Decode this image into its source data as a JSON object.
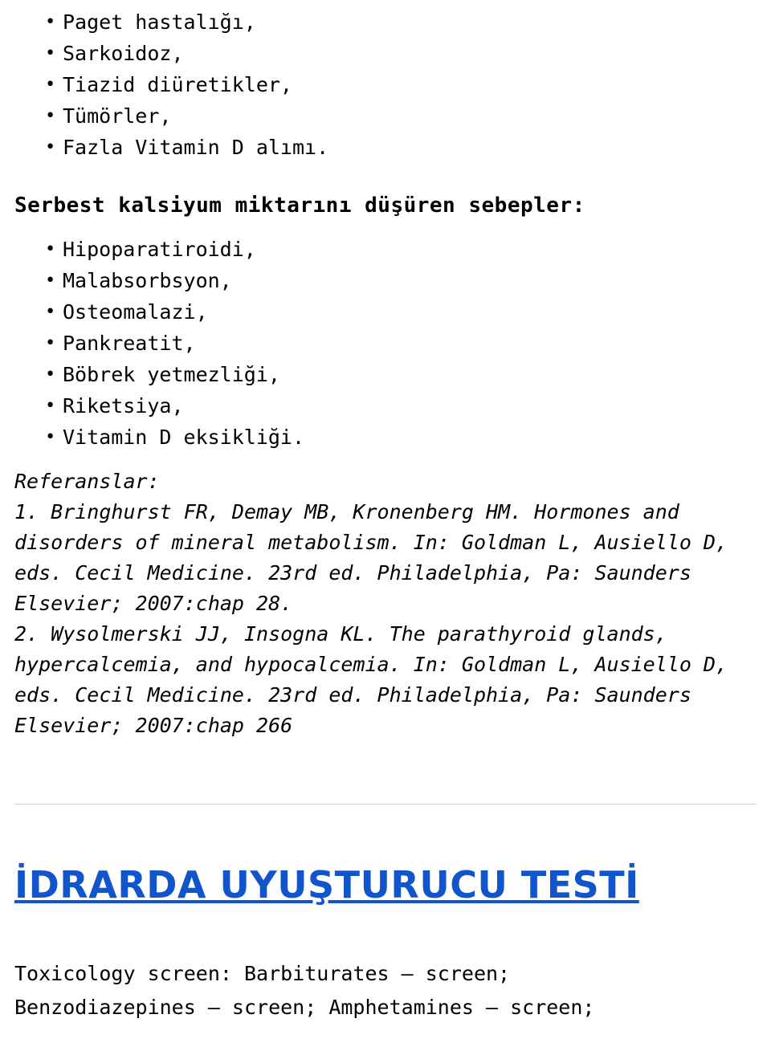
{
  "document": {
    "raising_causes_list": [
      "Paget hastalığı,",
      "Sarkoidoz,",
      "Tiazid diüretikler,",
      "Tümörler,",
      "Fazla Vitamin D alımı."
    ],
    "lowering_heading": "Serbest kalsiyum miktarını düşüren sebepler:",
    "lowering_causes_list": [
      "Hipoparatiroidi,",
      "Malabsorbsyon,",
      "Osteomalazi,",
      "Pankreatit,",
      "Böbrek yetmezliği,",
      "Riketsiya,",
      "Vitamin D eksikliği."
    ],
    "references_label": "Referanslar:",
    "references": [
      "1. Bringhurst FR, Demay MB, Kronenberg HM. Hormones and",
      "disorders of mineral metabolism. In: Goldman L, Ausiello D,",
      "eds. Cecil Medicine. 23rd ed. Philadelphia, Pa: Saunders",
      "Elsevier; 2007:chap 28.",
      "2. Wysolmerski JJ, Insogna KL. The parathyroid glands,",
      "hypercalcemia, and hypocalcemia. In: Goldman L, Ausiello D,",
      "eds. Cecil Medicine. 23rd ed. Philadelphia, Pa: Saunders",
      "Elsevier; 2007:chap 266"
    ],
    "next_title": "İDRARDA UYUŞTURUCU TESTİ",
    "toxicology_lines": [
      "Toxicology screen: Barbiturates — screen;",
      "Benzodiazepines — screen; Amphetamines — screen;"
    ]
  },
  "colors": {
    "link": "#1155cc",
    "text": "#000000",
    "divider": "#cccccc"
  }
}
